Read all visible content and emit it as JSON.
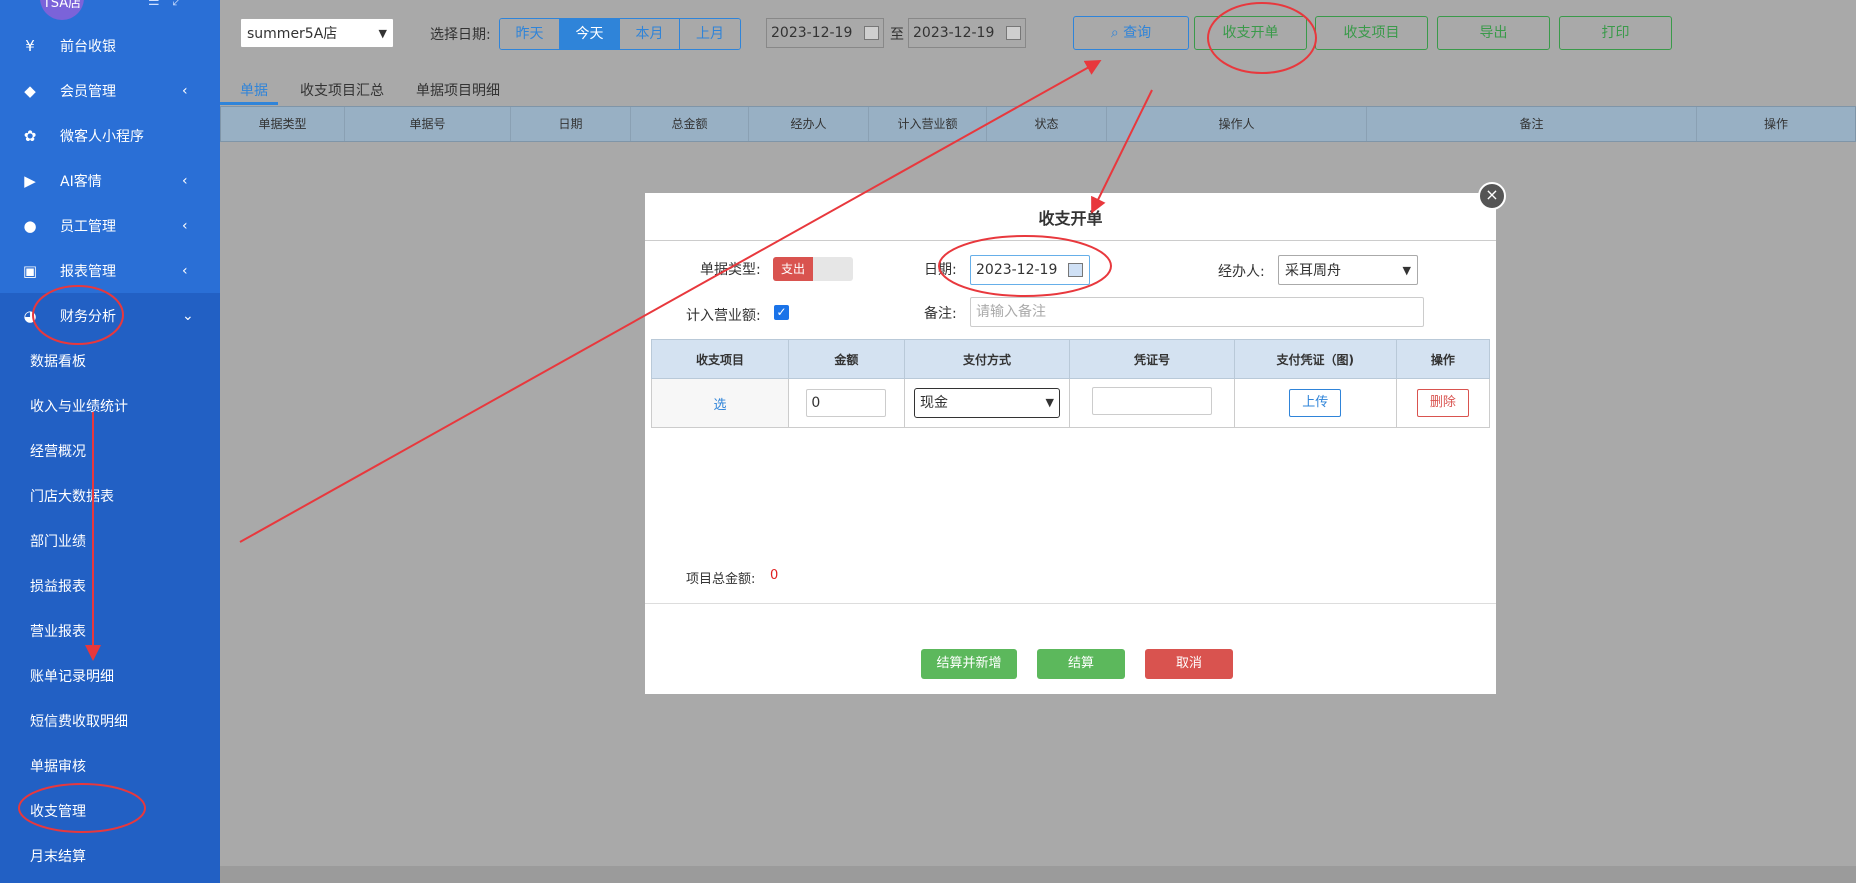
{
  "sidebar": {
    "avatar_text": "TSA店",
    "items": [
      {
        "label": "前台收银",
        "icon": "yen-icon"
      },
      {
        "label": "会员管理",
        "icon": "diamond-icon"
      },
      {
        "label": "微客人小程序",
        "icon": "grid-icon"
      },
      {
        "label": "AI客情",
        "icon": "play-icon"
      },
      {
        "label": "员工管理",
        "icon": "user-icon"
      },
      {
        "label": "报表管理",
        "icon": "monitor-icon"
      },
      {
        "label": "财务分析",
        "icon": "pie-icon"
      }
    ],
    "sub_items": [
      "数据看板",
      "收入与业绩统计",
      "经营概况",
      "门店大数据表",
      "部门业绩",
      "损益报表",
      "营业报表",
      "账单记录明细",
      "短信费收取明细",
      "单据审核",
      "收支管理",
      "月末结算"
    ]
  },
  "toolbar": {
    "store_select": "summer5A店",
    "date_label": "选择日期:",
    "date_buttons": [
      "昨天",
      "今天",
      "本月",
      "上月"
    ],
    "active_date_button": "今天",
    "date_from": "2023-12-19",
    "date_to_sep": "至",
    "date_to": "2023-12-19",
    "query_label": "查询",
    "open_bill_label": "收支开单",
    "items_label": "收支项目",
    "export_label": "导出",
    "print_label": "打印"
  },
  "tabs": [
    "单据",
    "收支项目汇总",
    "单据项目明细"
  ],
  "table_headers": [
    "单据类型",
    "单据号",
    "日期",
    "总金额",
    "经办人",
    "计入营业额",
    "状态",
    "操作人",
    "备注",
    "操作"
  ],
  "modal": {
    "title": "收支开单",
    "bill_type_label": "单据类型:",
    "bill_type_value": "支出",
    "date_label": "日期:",
    "date_value": "2023-12-19",
    "handler_label": "经办人:",
    "handler_value": "采耳周舟",
    "revenue_label": "计入营业额:",
    "revenue_checked": true,
    "remark_label": "备注:",
    "remark_placeholder": "请输入备注",
    "columns": [
      "收支项目",
      "金额",
      "支付方式",
      "凭证号",
      "支付凭证（图)",
      "操作"
    ],
    "row": {
      "item": "选",
      "amount": "0",
      "payment": "现金",
      "voucher": "",
      "upload": "上传",
      "delete": "删除"
    },
    "total_label": "项目总金额:",
    "total_value": "0",
    "btn_settle_new": "结算并新增",
    "btn_settle": "结算",
    "btn_cancel": "取消",
    "close": "×"
  },
  "colors": {
    "sidebar": "#2a6fd6",
    "accent": "#2f84d9",
    "green": "#5cb85c",
    "red": "#d9534f",
    "annotation": "#e8383d"
  }
}
